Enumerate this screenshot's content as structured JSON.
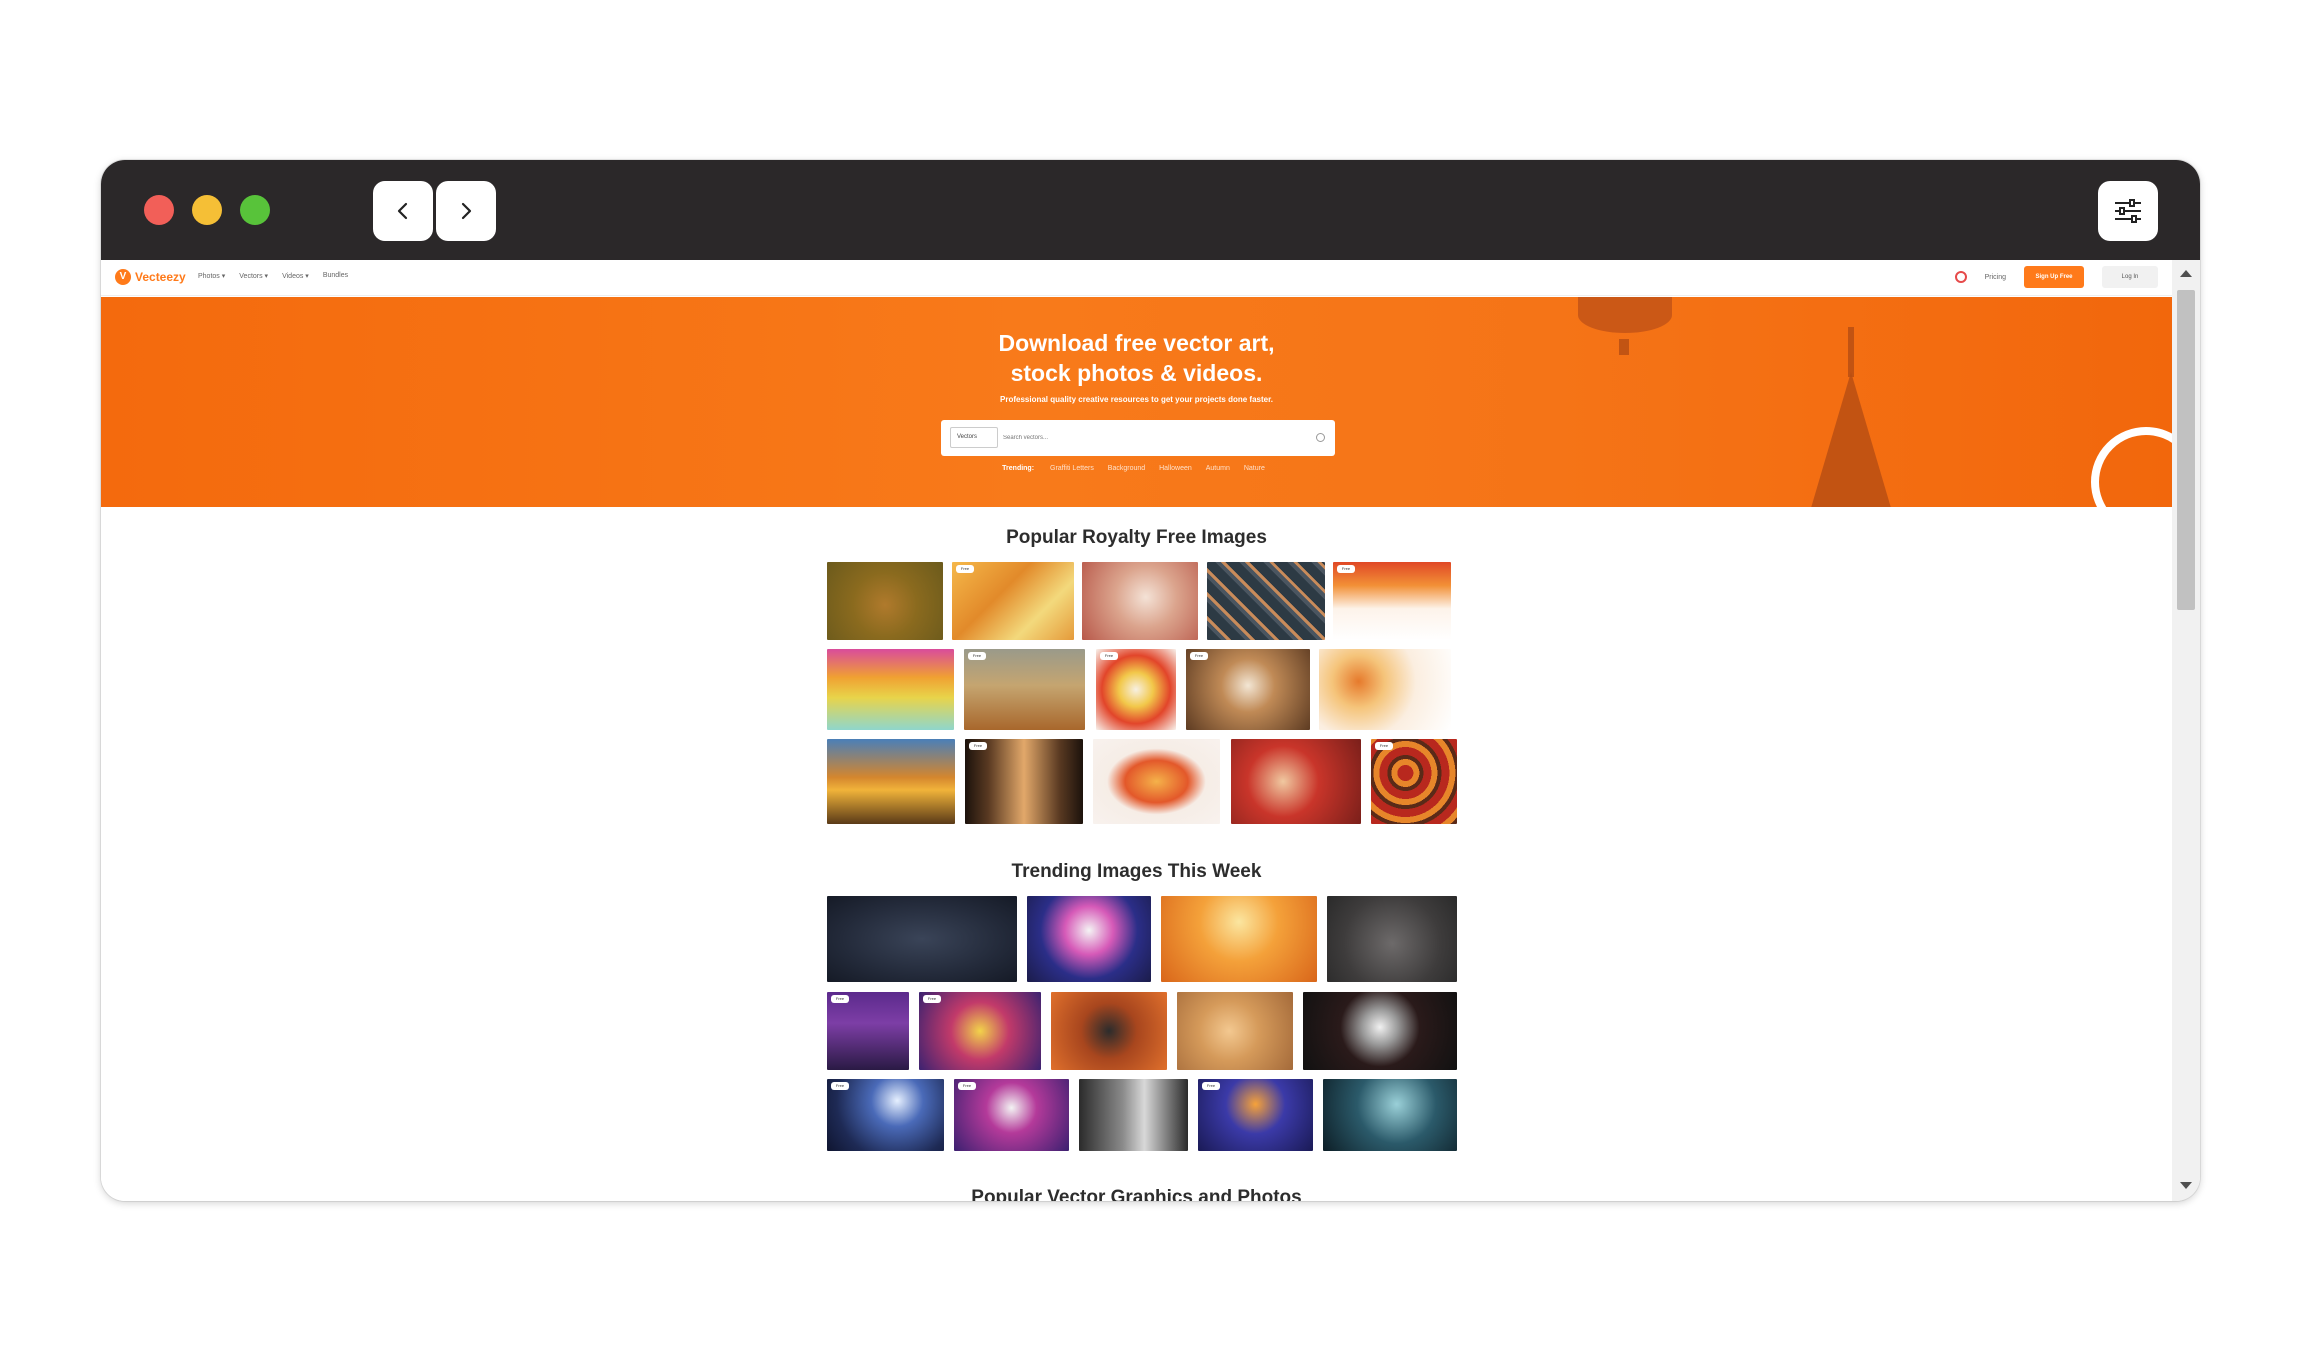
{
  "site": {
    "logo_text": "Vecteezy",
    "nav": [
      "Photos ▾",
      "Vectors ▾",
      "Videos ▾",
      "Bundles"
    ],
    "pricing": "Pricing",
    "signup": "Sign Up Free",
    "login": "Log In"
  },
  "hero": {
    "title_line1": "Download free vector art,",
    "title_line2": "stock photos & videos.",
    "subtitle": "Professional quality creative resources to get your projects done faster.",
    "search_type": "Vectors",
    "search_placeholder": "Search vectors...",
    "trending_label": "Trending:",
    "trending_terms": [
      "Graffiti Letters",
      "Background",
      "Halloween",
      "Autumn",
      "Nature"
    ]
  },
  "sections": {
    "popular_title": "Popular Royalty Free Images",
    "trending_title": "Trending Images This Week",
    "next_title": "Popular Vector Graphics and Photos"
  },
  "badge_free": "Free",
  "colors": {
    "chrome": "#2b2829",
    "brand_orange": "#ff7a1a",
    "hero_orange": "#f57417"
  }
}
